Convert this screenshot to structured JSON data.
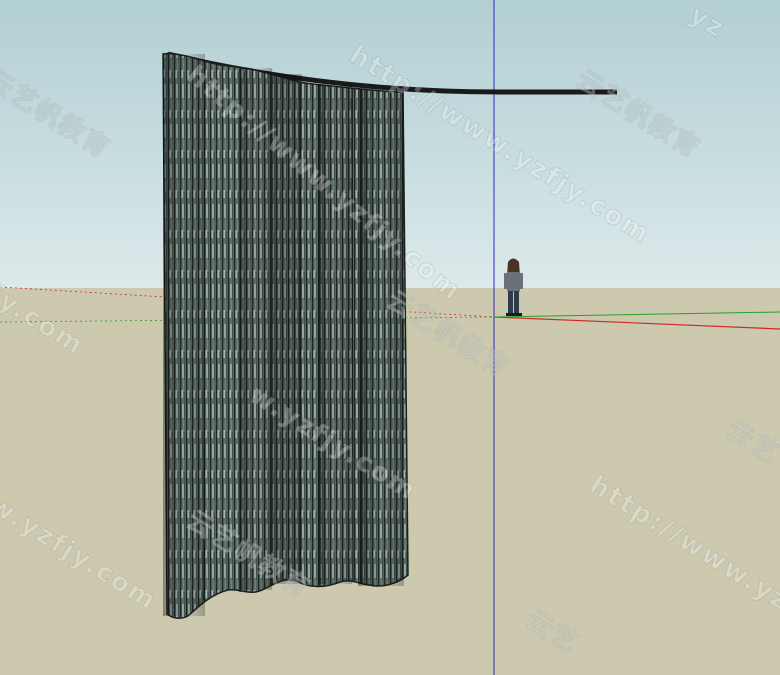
{
  "scene": {
    "sky_color": "#c4dadd",
    "ground_color": "#cdc9ae",
    "axis_colors": {
      "red": "#cc2a2a",
      "green": "#2aa02a",
      "blue": "#2a2acc"
    },
    "model_name": "curtain-model",
    "figure": "person-scale-figure"
  },
  "watermarks": {
    "brand": "云艺帆教育",
    "url": "http://www.yzfjy.com",
    "url_short": "w.yzfjy.com",
    "fragment_a": "yz",
    "fragment_b": "jy.com",
    "fragment_c": "云艺"
  }
}
